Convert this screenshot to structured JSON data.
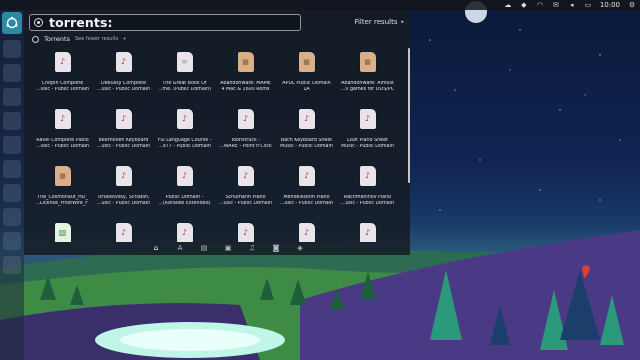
{
  "top_panel": {
    "tray_icons": [
      "weather-icon",
      "dropbox-icon",
      "wifi-icon",
      "mail-icon",
      "volume-icon",
      "battery-icon",
      "settings-icon"
    ],
    "clock": "10:00"
  },
  "launcher": {
    "items": [
      "dash-home",
      "app-1",
      "app-2",
      "app-3",
      "app-4",
      "app-5",
      "app-6",
      "app-7",
      "app-8",
      "app-9",
      "app-10"
    ]
  },
  "dash": {
    "search": {
      "query": "torrents:"
    },
    "filter_label": "Filter results",
    "filter_arrow": "▸",
    "section": {
      "title": "Torrents",
      "see_fewer": "See fewer results",
      "see_fewer_arrow": "▾"
    },
    "items": [
      {
        "label": "Chopin Complete\n...usic - Public Domain",
        "kind": "music"
      },
      {
        "label": "Debussy Complete\n...usic - Public Domain",
        "kind": "music"
      },
      {
        "label": "The Great Book Of\n...me. (Public Domain)",
        "kind": "plain"
      },
      {
        "label": "Abandonware: MAME\n4 Mac & 1600 Roms",
        "kind": "archive"
      },
      {
        "label": "APDL Public Domain\n1A",
        "kind": "archive"
      },
      {
        "label": "Abandonware: Almost\n...0 games for DOS/PC",
        "kind": "archive"
      },
      {
        "label": "Ravel Complete Piano\n...usic - Public Domain",
        "kind": "music"
      },
      {
        "label": "Beethoven Keyboard\n...usic - Public Domain",
        "kind": "music"
      },
      {
        "label": "FSI Language Course -\n...977 - Public Domain",
        "kind": "music"
      },
      {
        "label": "Toonstruck -\n...WARE - Point'n'Click",
        "kind": "music"
      },
      {
        "label": "Bach Keyboard Sheet\nMusic - Public Domain",
        "kind": "music"
      },
      {
        "label": "Liszt Piano Sheet\nMusic - Public Domain",
        "kind": "music"
      },
      {
        "label": "The_Cosmonaut_HD_\n..License_FrostWire_F",
        "kind": "archive"
      },
      {
        "label": "Tchaikovsky, Scriabin,\n...usic - Public Domain",
        "kind": "music"
      },
      {
        "label": "Public Domain -\n...(Karaoke Extended)",
        "kind": "music"
      },
      {
        "label": "Schumann Piano\n...usic - Public Domain",
        "kind": "music"
      },
      {
        "label": "Mendelssohn Piano\n...usic - Public Domain",
        "kind": "music"
      },
      {
        "label": "Rachmaninov Piano\n...usic - Public Domain",
        "kind": "music"
      },
      {
        "label": "",
        "kind": "sheet"
      },
      {
        "label": "",
        "kind": "music"
      },
      {
        "label": "",
        "kind": "music"
      },
      {
        "label": "",
        "kind": "music"
      },
      {
        "label": "",
        "kind": "music"
      },
      {
        "label": "",
        "kind": "music"
      }
    ],
    "lenses": [
      {
        "icon": "home-lens-icon",
        "glyph": "⌂",
        "active": true
      },
      {
        "icon": "applications-lens-icon",
        "glyph": "A"
      },
      {
        "icon": "files-lens-icon",
        "glyph": "▤"
      },
      {
        "icon": "video-lens-icon",
        "glyph": "▣"
      },
      {
        "icon": "music-lens-icon",
        "glyph": "♫"
      },
      {
        "icon": "photos-lens-icon",
        "glyph": "◙"
      },
      {
        "icon": "social-lens-icon",
        "glyph": "◈"
      }
    ]
  },
  "colors": {
    "music_note": "#b2235f",
    "home_button": "#2b8aa0",
    "dash_bg": "#161c24"
  }
}
